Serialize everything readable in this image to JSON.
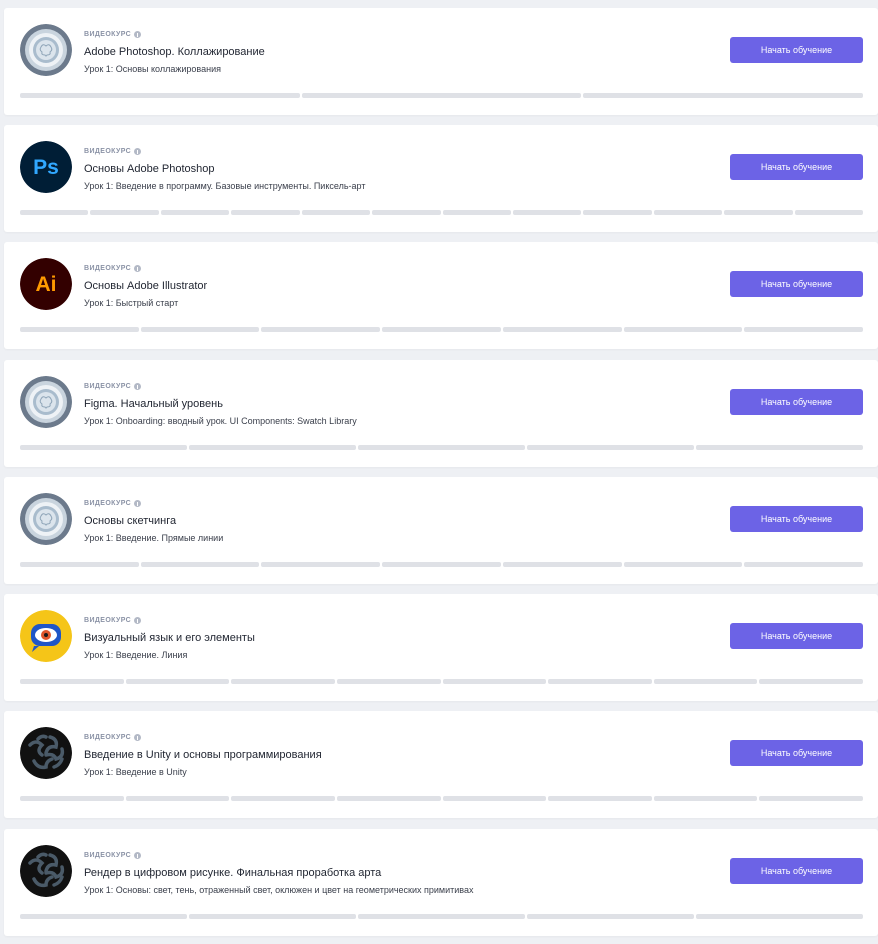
{
  "courses": [
    {
      "type_label": "ВИДЕОКУРС",
      "title": "Adobe Photoshop. Коллажирование",
      "lesson": "Урок 1: Основы коллажирования",
      "button_label": "Начать обучение",
      "icon": "default-course-icon",
      "segments": 3,
      "completed": 0
    },
    {
      "type_label": "ВИДЕОКУРС",
      "title": "Основы Adobe Photoshop",
      "lesson": "Урок 1: Введение в программу. Базовые инструменты. Пиксель-арт",
      "button_label": "Начать обучение",
      "icon": "photoshop-icon",
      "icon_text": "Ps",
      "segments": 12,
      "completed": 0
    },
    {
      "type_label": "ВИДЕОКУРС",
      "title": "Основы Adobe Illustrator",
      "lesson": "Урок 1: Быстрый старт",
      "button_label": "Начать обучение",
      "icon": "illustrator-icon",
      "icon_text": "Ai",
      "segments": 7,
      "completed": 0
    },
    {
      "type_label": "ВИДЕОКУРС",
      "title": "Figma. Начальный уровень",
      "lesson": "Урок 1: Onboarding: вводный урок. UI Components: Swatch Library",
      "button_label": "Начать обучение",
      "icon": "default-course-icon",
      "segments": 5,
      "completed": 0
    },
    {
      "type_label": "ВИДЕОКУРС",
      "title": "Основы скетчинга",
      "lesson": "Урок 1: Введение. Прямые линии",
      "button_label": "Начать обучение",
      "icon": "default-course-icon",
      "segments": 7,
      "completed": 0
    },
    {
      "type_label": "ВИДЕОКУРС",
      "title": "Визуальный язык и его элементы",
      "lesson": "Урок 1: Введение. Линия",
      "button_label": "Начать обучение",
      "icon": "eye-icon",
      "segments": 8,
      "completed": 0
    },
    {
      "type_label": "ВИДЕОКУРС",
      "title": "Введение в Unity и основы программирования",
      "lesson": "Урок 1: Введение в Unity",
      "button_label": "Начать обучение",
      "icon": "brain-icon",
      "segments": 8,
      "completed": 0
    },
    {
      "type_label": "ВИДЕОКУРС",
      "title": "Рендер в цифровом рисунке. Финальная проработка арта",
      "lesson": "Урок 1: Основы: свет, тень, отраженный свет, оклюжен и цвет на геометрических примитивах",
      "button_label": "Начать обучение",
      "icon": "brain-icon",
      "segments": 5,
      "completed": 0
    }
  ],
  "colors": {
    "accent": "#6c63e6",
    "progress_track": "#dfe1e6",
    "page_bg": "#eef0f4"
  }
}
